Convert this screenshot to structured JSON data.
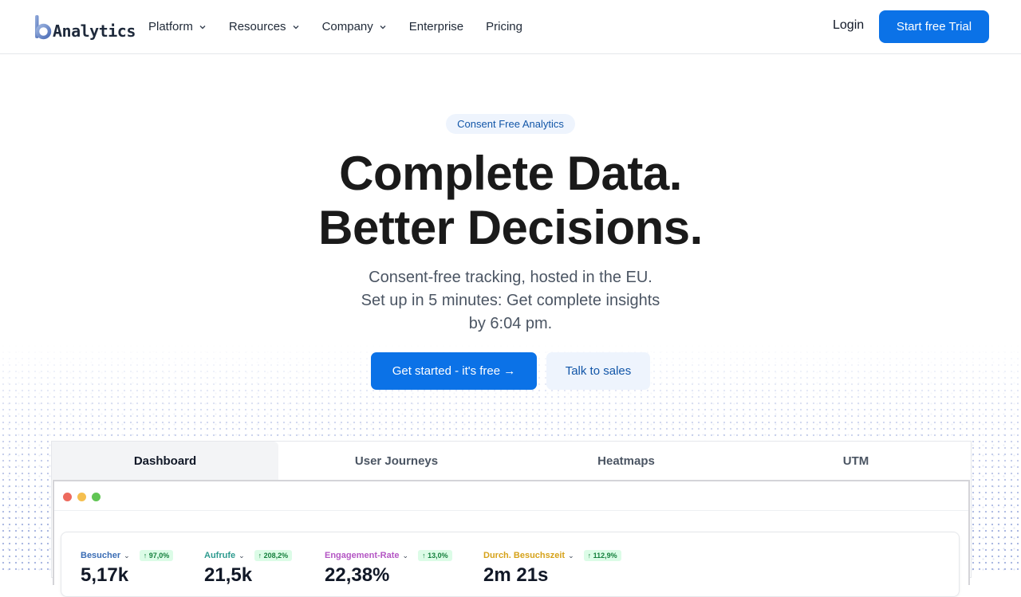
{
  "brand": {
    "logo_text": "Analytics",
    "logo_mark": "b",
    "accent": "#0b72e7"
  },
  "nav": {
    "items": [
      {
        "label": "Platform",
        "has_dropdown": true
      },
      {
        "label": "Resources",
        "has_dropdown": true
      },
      {
        "label": "Company",
        "has_dropdown": true
      },
      {
        "label": "Enterprise",
        "has_dropdown": false
      },
      {
        "label": "Pricing",
        "has_dropdown": false
      }
    ],
    "login": "Login",
    "cta": "Start free Trial"
  },
  "hero": {
    "badge": "Consent Free Analytics",
    "headline_1": "Complete Data.",
    "headline_2": "Better Decisions.",
    "sub_1": "Consent-free tracking, hosted in the EU.",
    "sub_2": "Set up in 5 minutes: Get complete insights",
    "sub_3": "by 6:04 pm.",
    "primary_cta": "Get started - it's free →",
    "secondary_cta": "Talk to sales"
  },
  "preview": {
    "tabs": [
      {
        "label": "Dashboard",
        "active": true
      },
      {
        "label": "User Journeys",
        "active": false
      },
      {
        "label": "Heatmaps",
        "active": false
      },
      {
        "label": "UTM",
        "active": false
      }
    ],
    "window_dots": [
      "#ed6a5e",
      "#f5bf4f",
      "#61c554"
    ],
    "metrics": [
      {
        "label": "Besucher",
        "delta": "↑ 97,0%",
        "value": "5,17k",
        "color": "#3b6db5"
      },
      {
        "label": "Aufrufe",
        "delta": "↑ 208,2%",
        "value": "21,5k",
        "color": "#2e9b8f"
      },
      {
        "label": "Engagement-Rate",
        "delta": "↑ 13,0%",
        "value": "22,38%",
        "color": "#b456c4"
      },
      {
        "label": "Durch. Besuchszeit",
        "delta": "↑ 112,9%",
        "value": "2m 21s",
        "color": "#d6a21a"
      }
    ]
  }
}
